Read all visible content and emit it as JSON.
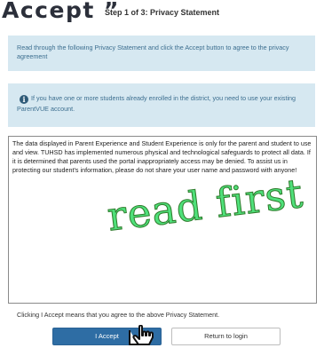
{
  "header": {
    "big_heading": "Accept ”",
    "step_title": "Step 1 of 3: Privacy Statement"
  },
  "instruction": {
    "text": "Read through the following Privacy Statement and click the Accept button to agree to the privacy agreement"
  },
  "info": {
    "icon": "info-icon",
    "text": "If you have one or more students already enrolled in the district, you need to use your existing ParentVUE account."
  },
  "statement": {
    "text": "The data displayed in Parent Experience and Student Experience is only for the parent and student to use and view. TUHSD has implemented numerous physical and technological safeguards to protect all data. If it is determined that parents used the portal inappropriately access may be denied. To assist us in protecting our student's information, please do not share your user name and password with anyone!"
  },
  "overlay": {
    "annotation": "read first"
  },
  "footer": {
    "agreement_text": "Clicking I Accept means that you agree to the above Privacy Statement.",
    "accept_label": "I Accept",
    "return_label": "Return to login"
  },
  "colors": {
    "accent": "#2e6da4",
    "info_background": "#d6e8f1",
    "annotation_fill": "#4fe07a"
  }
}
